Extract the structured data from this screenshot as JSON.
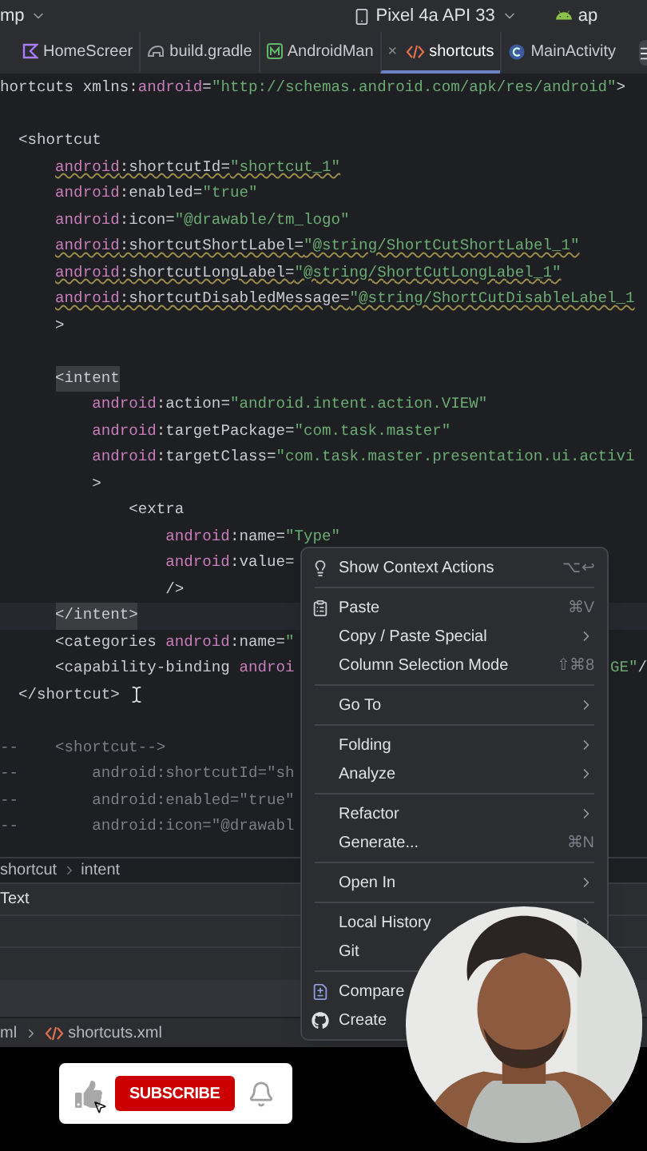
{
  "toolbar": {
    "project": "mp",
    "device": "Pixel 4a API 33",
    "app": "ap"
  },
  "tabs": [
    {
      "label": "HomeScreer",
      "selected": false
    },
    {
      "label": "build.gradle",
      "selected": false
    },
    {
      "label": "AndroidMan",
      "selected": false
    },
    {
      "label": "shortcuts",
      "selected": true,
      "close": "×"
    },
    {
      "label": "MainActivity",
      "selected": false
    }
  ],
  "editor": {
    "lines": [
      {
        "kind": "code",
        "tokens": [
          {
            "kind": "plain",
            "text": "hortcuts xmlns:"
          },
          {
            "kind": "ns",
            "text": "android"
          },
          {
            "kind": "plain",
            "text": "="
          },
          {
            "kind": "value",
            "text": "\"http://schemas.android.com/apk/res/android\""
          },
          {
            "kind": "plain",
            "text": ">"
          }
        ]
      },
      {
        "kind": "blank"
      },
      {
        "kind": "code",
        "tokens": [
          {
            "kind": "plain",
            "text": "  <shortcut"
          }
        ]
      },
      {
        "kind": "code",
        "warning": true,
        "tokens": [
          {
            "kind": "ns",
            "text": "      android"
          },
          {
            "kind": "plain",
            "text": ":shortcutId="
          },
          {
            "kind": "value",
            "text": "\"shortcut_1\""
          }
        ]
      },
      {
        "kind": "code",
        "tokens": [
          {
            "kind": "ns",
            "text": "      android"
          },
          {
            "kind": "plain",
            "text": ":enabled="
          },
          {
            "kind": "value",
            "text": "\"true\""
          }
        ]
      },
      {
        "kind": "code",
        "tokens": [
          {
            "kind": "ns",
            "text": "      android"
          },
          {
            "kind": "plain",
            "text": ":icon="
          },
          {
            "kind": "value",
            "text": "\"@drawable/tm_logo\""
          }
        ]
      },
      {
        "kind": "code",
        "warning": true,
        "tokens": [
          {
            "kind": "ns",
            "text": "      android"
          },
          {
            "kind": "plain",
            "text": ":shortcutShortLabel="
          },
          {
            "kind": "value",
            "text": "\"@string/ShortCutShortLabel_1\""
          }
        ]
      },
      {
        "kind": "code",
        "warning": true,
        "tokens": [
          {
            "kind": "ns",
            "text": "      android"
          },
          {
            "kind": "plain",
            "text": ":shortcutLongLabel="
          },
          {
            "kind": "value",
            "text": "\"@string/ShortCutLongLabel_1\""
          }
        ]
      },
      {
        "kind": "code",
        "warning": true,
        "tokens": [
          {
            "kind": "ns",
            "text": "      android"
          },
          {
            "kind": "plain",
            "text": ":shortcutDisabledMessage="
          },
          {
            "kind": "value",
            "text": "\"@string/ShortCutDisableLabel_1"
          }
        ]
      },
      {
        "kind": "code",
        "tokens": [
          {
            "kind": "plain",
            "text": "      >"
          }
        ]
      },
      {
        "kind": "blank"
      },
      {
        "kind": "code",
        "tokens": [
          {
            "kind": "plain",
            "text": "      <intent",
            "highlighted": true
          }
        ]
      },
      {
        "kind": "code",
        "tokens": [
          {
            "kind": "ns",
            "text": "          android"
          },
          {
            "kind": "plain",
            "text": ":action="
          },
          {
            "kind": "value",
            "text": "\"android.intent.action.VIEW\""
          }
        ]
      },
      {
        "kind": "code",
        "tokens": [
          {
            "kind": "ns",
            "text": "          android"
          },
          {
            "kind": "plain",
            "text": ":targetPackage="
          },
          {
            "kind": "value",
            "text": "\"com.task.master\""
          }
        ]
      },
      {
        "kind": "code",
        "tokens": [
          {
            "kind": "ns",
            "text": "          android"
          },
          {
            "kind": "plain",
            "text": ":targetClass="
          },
          {
            "kind": "value",
            "text": "\"com.task.master.presentation.ui.activi"
          }
        ]
      },
      {
        "kind": "code",
        "tokens": [
          {
            "kind": "plain",
            "text": "          >"
          }
        ]
      },
      {
        "kind": "code",
        "tokens": [
          {
            "kind": "plain",
            "text": "              <extra"
          }
        ]
      },
      {
        "kind": "code",
        "tokens": [
          {
            "kind": "ns",
            "text": "                  android"
          },
          {
            "kind": "plain",
            "text": ":name="
          },
          {
            "kind": "value",
            "text": "\"Type\""
          }
        ]
      },
      {
        "kind": "code",
        "tokens": [
          {
            "kind": "ns",
            "text": "                  android"
          },
          {
            "kind": "plain",
            "text": ":value="
          }
        ]
      },
      {
        "kind": "code",
        "tokens": [
          {
            "kind": "plain",
            "text": "                  />"
          }
        ]
      },
      {
        "kind": "code",
        "current": true,
        "tokens": [
          {
            "kind": "plain",
            "text": "      </intent>",
            "highlighted": true
          }
        ]
      },
      {
        "kind": "code",
        "tokens": [
          {
            "kind": "plain",
            "text": "      <categories "
          },
          {
            "kind": "ns",
            "text": "android"
          },
          {
            "kind": "plain",
            "text": ":name="
          },
          {
            "kind": "value",
            "text": "\""
          }
        ]
      },
      {
        "kind": "code",
        "tokens": [
          {
            "kind": "plain",
            "text": "      <capability-binding "
          },
          {
            "kind": "ns",
            "text": "androi"
          }
        ],
        "tail": [
          {
            "kind": "value",
            "text": "GE\""
          },
          {
            "kind": "plain",
            "text": "/"
          }
        ]
      },
      {
        "kind": "code",
        "mouse_cursor": true,
        "tokens": [
          {
            "kind": "plain",
            "text": "  </shortcut>"
          }
        ]
      },
      {
        "kind": "blank"
      },
      {
        "kind": "code",
        "tokens": [
          {
            "kind": "comment",
            "text": "--    <shortcut-->"
          }
        ]
      },
      {
        "kind": "code",
        "tokens": [
          {
            "kind": "comment",
            "text": "--        android:shortcutId=\"sh"
          }
        ]
      },
      {
        "kind": "code",
        "tokens": [
          {
            "kind": "comment",
            "text": "--        android:enabled=\"true\""
          }
        ]
      },
      {
        "kind": "code",
        "tokens": [
          {
            "kind": "comment",
            "text": "--        android:icon=\"@drawabl"
          }
        ]
      }
    ]
  },
  "breadcrumb": [
    "shortcut",
    "intent"
  ],
  "panel": {
    "tab": "Text"
  },
  "status_bar": {
    "path": [
      "ml",
      "shortcuts.xml"
    ]
  },
  "context_menu": [
    {
      "kind": "item",
      "label": "Show Context Actions",
      "shortcut": "⌥↩",
      "submenu": false
    },
    {
      "kind": "separator"
    },
    {
      "kind": "item",
      "label": "Paste",
      "shortcut": "⌘V",
      "submenu": false
    },
    {
      "kind": "item",
      "label": "Copy / Paste Special",
      "submenu": true
    },
    {
      "kind": "item",
      "label": "Column Selection Mode",
      "shortcut": "⇧⌘8",
      "submenu": false
    },
    {
      "kind": "separator"
    },
    {
      "kind": "item",
      "label": "Go To",
      "submenu": true
    },
    {
      "kind": "separator"
    },
    {
      "kind": "item",
      "label": "Folding",
      "submenu": true
    },
    {
      "kind": "item",
      "label": "Analyze",
      "submenu": true
    },
    {
      "kind": "separator"
    },
    {
      "kind": "item",
      "label": "Refactor",
      "submenu": true
    },
    {
      "kind": "item",
      "label": "Generate...",
      "shortcut": "⌘N",
      "submenu": false
    },
    {
      "kind": "separator"
    },
    {
      "kind": "item",
      "label": "Open In",
      "submenu": true
    },
    {
      "kind": "separator"
    },
    {
      "kind": "item",
      "label": "Local History",
      "submenu": true
    },
    {
      "kind": "item",
      "label": "Git",
      "submenu": false
    },
    {
      "kind": "separator"
    },
    {
      "kind": "item",
      "label": "Compare",
      "submenu": false
    },
    {
      "kind": "item",
      "label": "Create",
      "submenu": false
    }
  ],
  "webcam": {
    "kind": "picture"
  },
  "subscribe": {
    "label": "SUBSCRIBE"
  }
}
